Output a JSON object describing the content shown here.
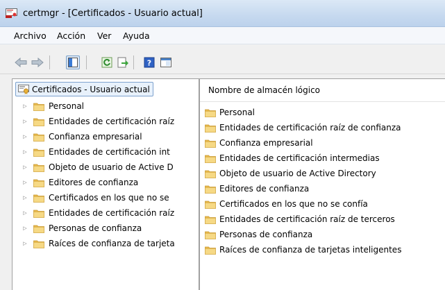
{
  "window": {
    "title": "certmgr - [Certificados - Usuario actual]",
    "icon": "certificate-manager-icon"
  },
  "menu": [
    "Archivo",
    "Acción",
    "Ver",
    "Ayuda"
  ],
  "toolbar": {
    "buttons": [
      "back-arrow-icon",
      "forward-arrow-icon",
      "show-hide-tree-icon",
      "refresh-icon",
      "export-list-icon",
      "help-icon",
      "properties-pane-icon"
    ]
  },
  "tree": {
    "root": "Certificados - Usuario actual",
    "items": [
      "Personal",
      "Entidades de certificación raíz",
      "Confianza empresarial",
      "Entidades de certificación int",
      "Objeto de usuario de Active D",
      "Editores de confianza",
      "Certificados en los que no se",
      "Entidades de certificación raíz",
      "Personas de confianza",
      "Raíces de confianza de tarjeta"
    ]
  },
  "list": {
    "column_header": "Nombre de almacén lógico",
    "items": [
      "Personal",
      "Entidades de certificación raíz de confianza",
      "Confianza empresarial",
      "Entidades de certificación intermedias",
      "Objeto de usuario de Active Directory",
      "Editores de confianza",
      "Certificados en los que no se confía",
      "Entidades de certificación raíz de terceros",
      "Personas de confianza",
      "Raíces de confianza de tarjetas inteligentes"
    ]
  },
  "colors": {
    "title_bar": "#c6d9ef",
    "folder_fill": "#f3d27a",
    "selection_border": "#7da2ce"
  }
}
